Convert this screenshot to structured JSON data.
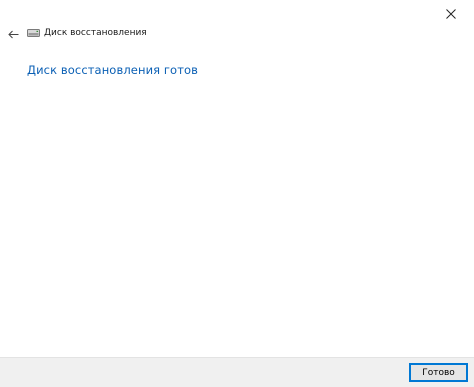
{
  "window": {
    "close_icon": "close-icon"
  },
  "header": {
    "back_icon": "back-arrow-icon",
    "drive_icon": "drive-icon",
    "title": "Диск восстановления"
  },
  "main": {
    "heading": "Диск восстановления готов",
    "heading_color": "#0a5fb4"
  },
  "footer": {
    "done_label": "Готово",
    "accent_color": "#0078d4"
  }
}
